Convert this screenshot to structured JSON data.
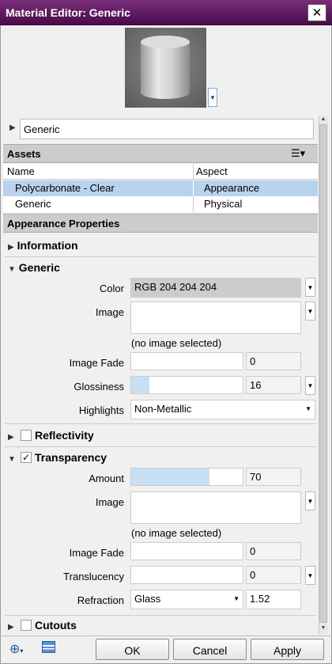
{
  "window": {
    "title": "Material Editor: Generic",
    "close_glyph": "✕"
  },
  "material_name": "Generic",
  "assets": {
    "header": "Assets",
    "columns": [
      "Name",
      "Aspect"
    ],
    "rows": [
      {
        "name": "Polycarbonate - Clear",
        "aspect": "Appearance",
        "selected": true
      },
      {
        "name": "Generic",
        "aspect": "Physical",
        "selected": false
      }
    ],
    "menu_icon": "list-menu-icon"
  },
  "appearance": {
    "header": "Appearance Properties"
  },
  "sections": {
    "information": "Information",
    "generic": "Generic",
    "reflectivity": "Reflectivity",
    "transparency": "Transparency",
    "cutouts": "Cutouts"
  },
  "generic": {
    "color_label": "Color",
    "color_value": "RGB 204 204 204",
    "image_label": "Image",
    "image_note": "(no image selected)",
    "image_fade_label": "Image Fade",
    "image_fade_value": "0",
    "glossiness_label": "Glossiness",
    "glossiness_value": "16",
    "highlights_label": "Highlights",
    "highlights_value": "Non-Metallic"
  },
  "transparency": {
    "checked": true,
    "amount_label": "Amount",
    "amount_value": "70",
    "image_label": "Image",
    "image_note": "(no image selected)",
    "image_fade_label": "Image Fade",
    "image_fade_value": "0",
    "translucency_label": "Translucency",
    "translucency_value": "0",
    "refraction_label": "Refraction",
    "refraction_select": "Glass",
    "refraction_value": "1.52"
  },
  "buttons": {
    "ok": "OK",
    "cancel": "Cancel",
    "apply": "Apply"
  },
  "colors": {
    "title_bar": "#5a135a",
    "selected_row": "#b9d3ee",
    "slider_fill": "#c9e0f4"
  }
}
